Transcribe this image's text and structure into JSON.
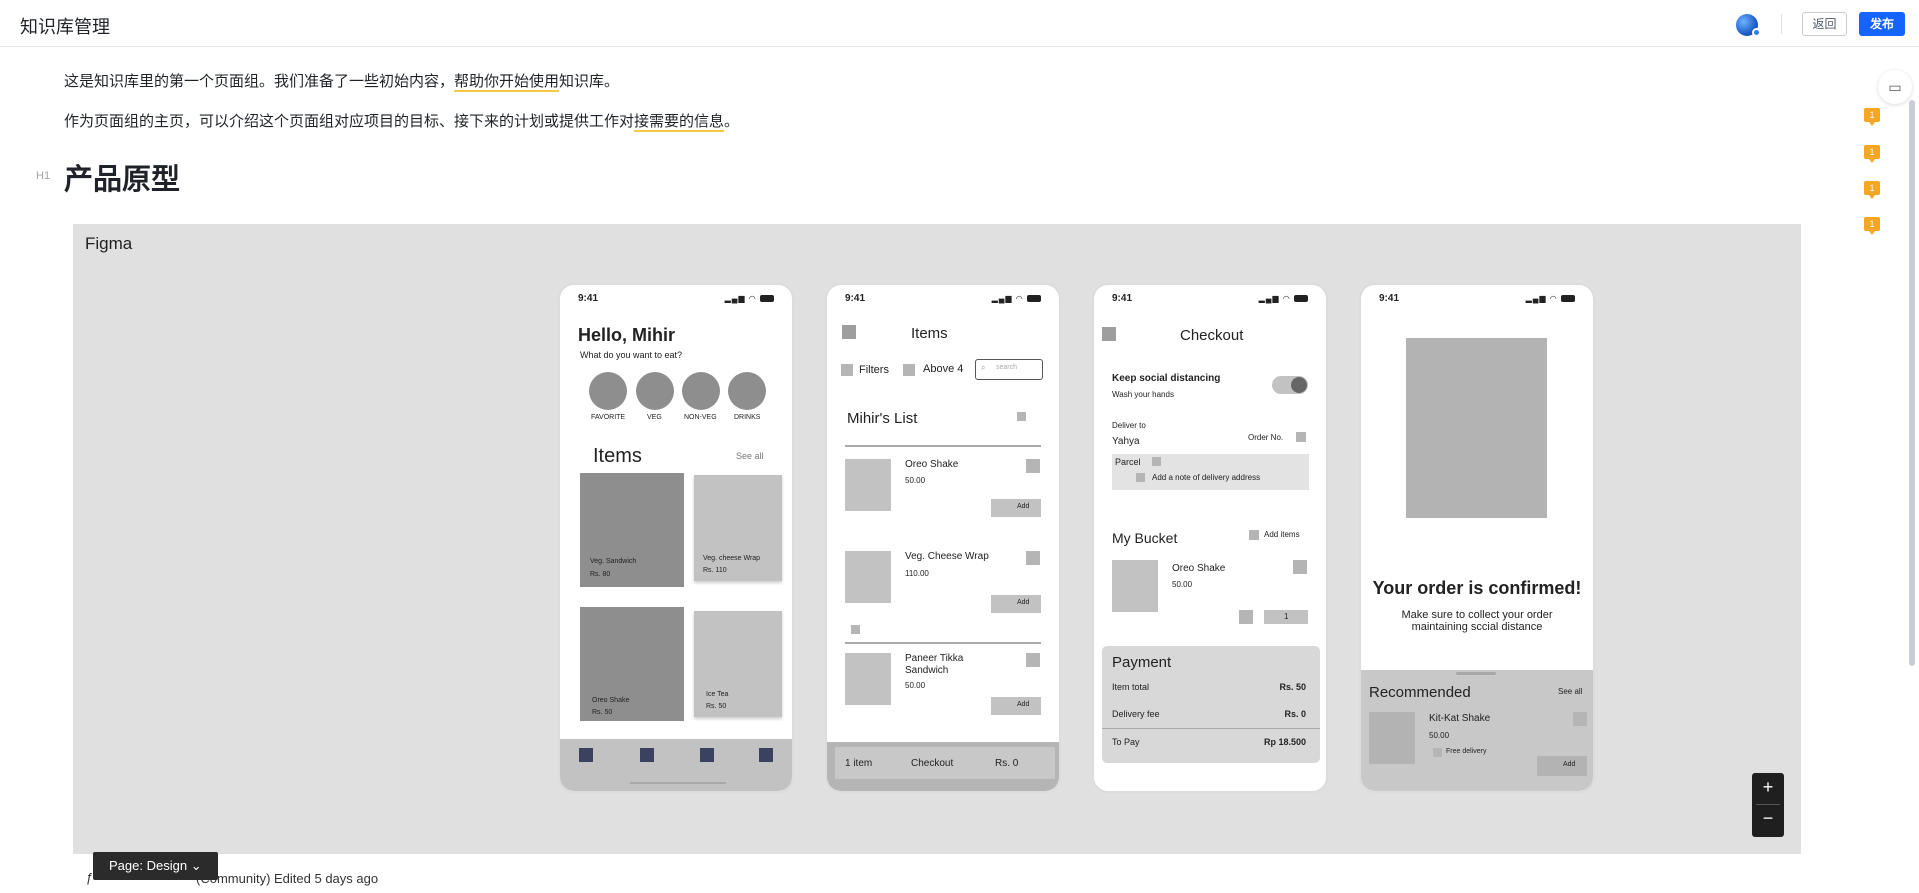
{
  "header": {
    "title": "知识库管理",
    "back_label": "返回",
    "publish_label": "发布"
  },
  "doc": {
    "p1_a": "这是知识库里的第一个页面组。我们准备了一些初始内容，",
    "p1_hl": "帮助你开始使用",
    "p1_b": "知识库。",
    "p2_a": "作为页面组的主页，可以介绍这个页面组对应项目的目标、接下来的计划或提供工作对",
    "p2_hl": "接需要的信息",
    "p2_b": "。",
    "heading_marker": "H1",
    "heading": "产品原型"
  },
  "embed": {
    "label": "Figma",
    "page_label": "Page: Design",
    "footer": "(Community) Edited 5 days ago",
    "zoom_in": "+",
    "zoom_out": "−"
  },
  "comments": {
    "counts": [
      "1",
      "1",
      "1",
      "1"
    ]
  },
  "screens": {
    "time": "9:41",
    "home": {
      "greeting": "Hello, Mihir",
      "sub": "What do you want to eat?",
      "cats": [
        "FAVORITE",
        "VEG",
        "NON-VEG",
        "DRINKS"
      ],
      "items_title": "Items",
      "see_all": "See all",
      "cards": [
        {
          "name": "Veg. Sandwich",
          "price": "Rs. 80"
        },
        {
          "name": "Veg. cheese Wrap",
          "price": "Rs. 110"
        },
        {
          "name": "Oreo Shake",
          "price": "Rs. 50"
        },
        {
          "name": "Ice Tea",
          "price": "Rs. 50"
        }
      ]
    },
    "items": {
      "title": "Items",
      "filters": "Filters",
      "above": "Above 4",
      "search_placeholder": "search",
      "list_title": "Mihir's List",
      "rows": [
        {
          "name": "Oreo Shake",
          "price": "50.00",
          "add": "Add"
        },
        {
          "name": "Veg. Cheese Wrap",
          "price": "110.00",
          "add": "Add"
        },
        {
          "name": "Paneer Tikka Sandwich",
          "price": "50.00",
          "add": "Add"
        }
      ],
      "bottom_count": "1 item",
      "bottom_checkout": "Checkout",
      "bottom_total": "Rs. 0"
    },
    "checkout": {
      "title": "Checkout",
      "distancing": "Keep social distancing",
      "wash": "Wash your hands",
      "deliver_to": "Deliver to",
      "name": "Yahya",
      "order_no": "Order No.",
      "parcel": "Parcel",
      "note": "Add a note of delivery address",
      "bucket": "My Bucket",
      "add_items": "Add items",
      "item_name": "Oreo Shake",
      "item_price": "50.00",
      "qty": "1",
      "payment": "Payment",
      "item_total": "Item total",
      "item_total_val": "Rs. 50",
      "delivery_fee": "Delivery fee",
      "delivery_fee_val": "Rs. 0",
      "to_pay": "To Pay",
      "to_pay_val": "Rp 18.500"
    },
    "confirm": {
      "title": "Your order is confirmed!",
      "sub": "Make sure to collect your order maintaining sccial distance",
      "rec": "Recommended",
      "see_all": "See all",
      "item": "Kit-Kat Shake",
      "price": "50.00",
      "free": "Free delivery",
      "add": "Add"
    }
  }
}
